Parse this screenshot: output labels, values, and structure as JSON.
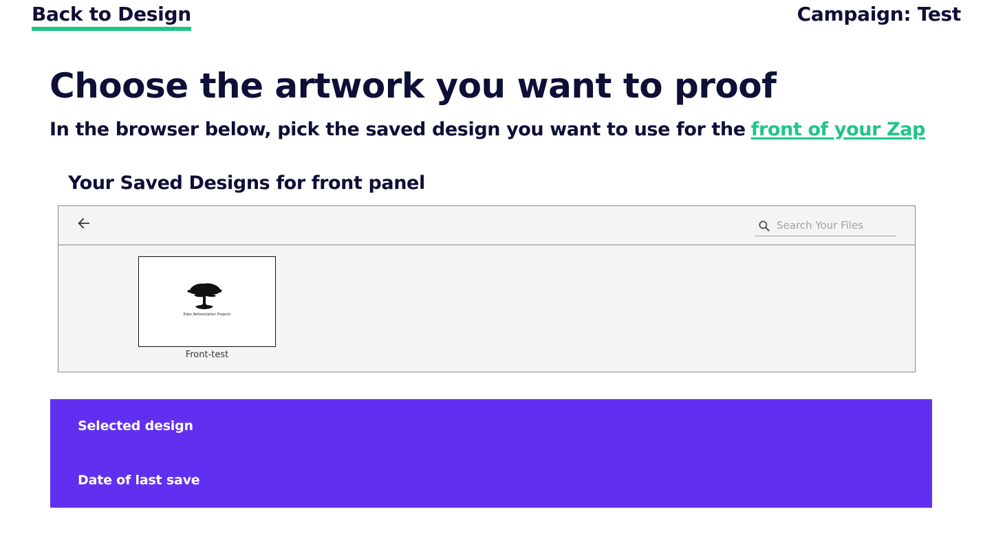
{
  "header": {
    "back_link": "Back to Design",
    "campaign_label": "Campaign:",
    "campaign_name": "Test",
    "accent_color": "#1fc586"
  },
  "main": {
    "title": "Choose the artwork you want to proof",
    "subtitle_text": "In the browser below, pick the saved design you want to use for the",
    "subtitle_link": "front of your Zap"
  },
  "saved_designs": {
    "heading": "Your Saved Designs for front panel",
    "back_icon": "arrow-left-icon",
    "search": {
      "icon": "search-icon",
      "placeholder": "Search Your Files",
      "value": ""
    },
    "files": [
      {
        "name": "Front-test",
        "thumbnail_caption": "Eden Reforestation Projects",
        "thumbnail_icon": "tree-icon"
      }
    ]
  },
  "selection": {
    "background_color": "#612ff0",
    "selected_design_label": "Selected design",
    "last_save_label": "Date of last save"
  }
}
